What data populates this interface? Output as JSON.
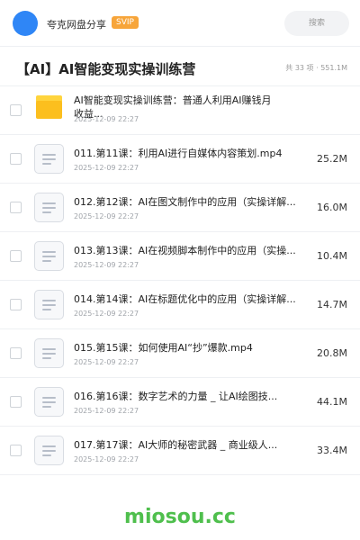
{
  "topbar": {
    "username": "夸克网盘分享",
    "badge": "SVIP",
    "search_placeholder": "搜索"
  },
  "header": {
    "title": "【AI】AI智能变现实操训练营",
    "meta": "共 33 项 · 551.1M"
  },
  "items": [
    {
      "type": "folder",
      "name": "AI智能变现实操训练营：普通人利用AI赚钱月收益...",
      "date": "2025-12-09 22:27",
      "size": ""
    },
    {
      "type": "file",
      "name": "011.第11课：利用AI进行自媒体内容策划.mp4",
      "date": "2025-12-09 22:27",
      "size": "25.2M"
    },
    {
      "type": "file",
      "name": "012.第12课：AI在图文制作中的应用（实操详解...",
      "date": "2025-12-09 22:27",
      "size": "16.0M"
    },
    {
      "type": "file",
      "name": "013.第13课：AI在视频脚本制作中的应用（实操...",
      "date": "2025-12-09 22:27",
      "size": "10.4M"
    },
    {
      "type": "file",
      "name": "014.第14课：AI在标题优化中的应用（实操详解...",
      "date": "2025-12-09 22:27",
      "size": "14.7M"
    },
    {
      "type": "file",
      "name": "015.第15课：如何使用AI“抄”爆款.mp4",
      "date": "2025-12-09 22:27",
      "size": "20.8M"
    },
    {
      "type": "file",
      "name": "016.第16课：数字艺术的力量 _ 让AI绘图技...",
      "date": "2025-12-09 22:27",
      "size": "44.1M"
    },
    {
      "type": "file",
      "name": "017.第17课：AI大师的秘密武器 _ 商业级人...",
      "date": "2025-12-09 22:27",
      "size": "33.4M"
    }
  ],
  "watermark": "miosou.cc"
}
